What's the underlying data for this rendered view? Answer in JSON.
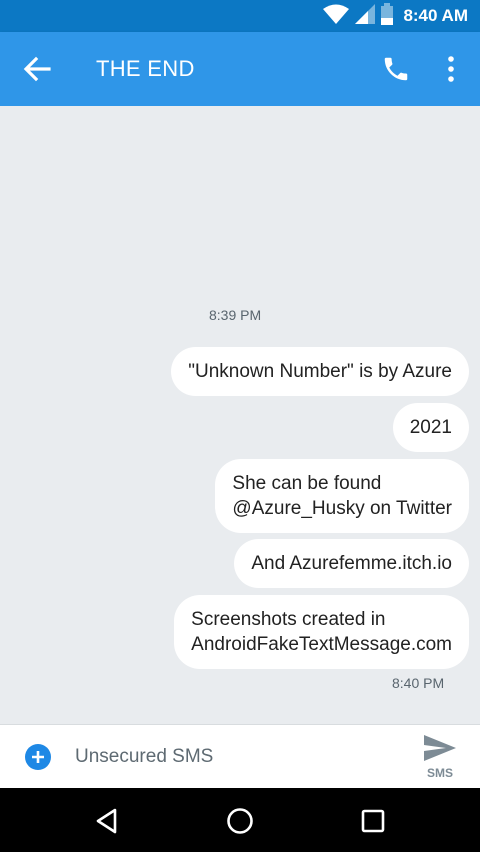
{
  "status_bar": {
    "time": "8:40 AM"
  },
  "app_bar": {
    "title": "THE END"
  },
  "conversation": {
    "timestamp_top": "8:39 PM",
    "messages": [
      "\"Unknown Number\" is by Azure",
      "2021",
      "She can be found\n@Azure_Husky on Twitter",
      "And Azurefemme.itch.io",
      "Screenshots created in\nAndroidFakeTextMessage.com"
    ],
    "timestamp_bottom": "8:40 PM"
  },
  "compose": {
    "placeholder": "Unsecured SMS",
    "send_label": "SMS"
  },
  "colors": {
    "status_bar": "#0c78c4",
    "app_bar": "#2f96e8",
    "conversation_bg": "#e9ecef",
    "accent": "#1e88e5"
  }
}
